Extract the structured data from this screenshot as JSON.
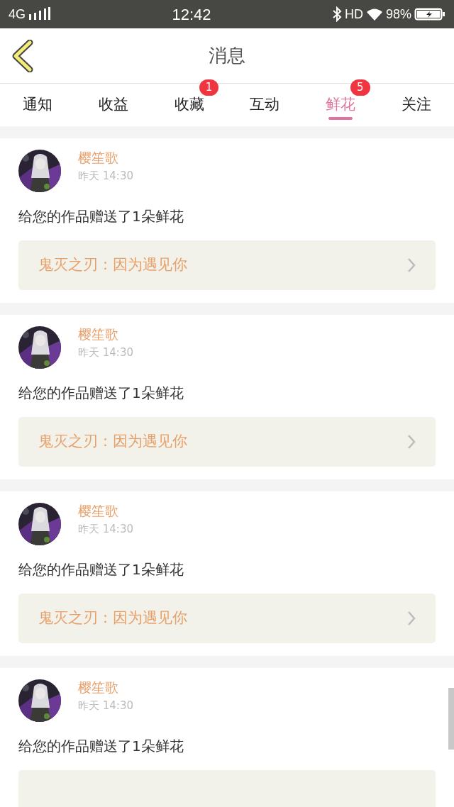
{
  "status_bar": {
    "network": "4G",
    "time": "12:42",
    "hd": "HD",
    "battery": "98%"
  },
  "header": {
    "title": "消息"
  },
  "tabs": [
    {
      "label": "通知",
      "selected": false
    },
    {
      "label": "收益",
      "selected": false
    },
    {
      "label": "收藏",
      "selected": false,
      "badge": "1"
    },
    {
      "label": "互动",
      "selected": false
    },
    {
      "label": "鲜花",
      "selected": true,
      "badge": "5"
    },
    {
      "label": "关注",
      "selected": false
    }
  ],
  "messages": [
    {
      "name": "樱笙歌",
      "time": "昨天 14:30",
      "text": "给您的作品赠送了1朵鲜花",
      "link": "鬼灭之刃：因为遇见你"
    },
    {
      "name": "樱笙歌",
      "time": "昨天 14:30",
      "text": "给您的作品赠送了1朵鲜花",
      "link": "鬼灭之刃：因为遇见你"
    },
    {
      "name": "樱笙歌",
      "time": "昨天 14:30",
      "text": "给您的作品赠送了1朵鲜花",
      "link": "鬼灭之刃：因为遇见你"
    },
    {
      "name": "樱笙歌",
      "time": "昨天 14:30",
      "text": "给您的作品赠送了1朵鲜花"
    }
  ]
}
